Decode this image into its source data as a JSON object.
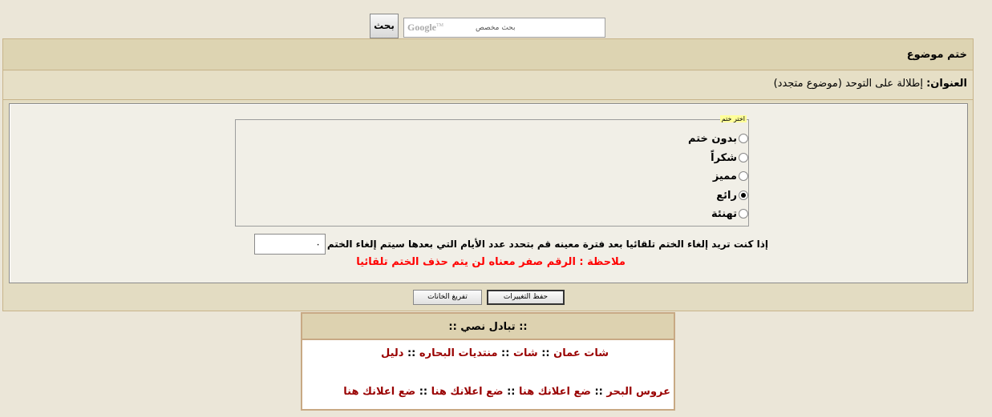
{
  "search": {
    "button_label": "بحث",
    "placeholder": "بحث مخصص",
    "brand": "Google",
    "brand_tm": "TM"
  },
  "panel": {
    "title": "ختم موضوع",
    "title_label": "العنوان:",
    "thread_title": "إطلالة على التوحد (موضوع متجدد)"
  },
  "stamp": {
    "legend": "اختر ختم",
    "options": [
      {
        "label": "بدون ختم",
        "selected": false
      },
      {
        "label": "شكراً",
        "selected": false
      },
      {
        "label": "مميز",
        "selected": false
      },
      {
        "label": "رائع",
        "selected": true
      },
      {
        "label": "تهنئة",
        "selected": false
      }
    ]
  },
  "days": {
    "label": "إذا كنت تريد إلغاء الختم تلقائيا بعد فترة معينه قم بتحدد عدد الأيام التي بعدها سيتم إلغاء الختم",
    "value": "٠"
  },
  "note": "ملاحظة : الرقم صفر معناه لن يتم حذف الختم تلقائيا",
  "buttons": {
    "save": "حفظ التغييرات",
    "reset": "تفريغ الخانات"
  },
  "exchange": {
    "title": ":: تبادل نصي ::",
    "row1": [
      "شات عمان",
      "شات",
      "منتديات البحاره",
      "دليل"
    ],
    "row2": [
      "عروس البحر",
      "ضع اعلانك هنا",
      "ضع اعلانك هنا",
      "ضع اعلانك هنا"
    ],
    "separator": "::"
  },
  "colors": {
    "note": "#ff0000",
    "link": "#990000",
    "legend_bg": "#ffff99"
  }
}
